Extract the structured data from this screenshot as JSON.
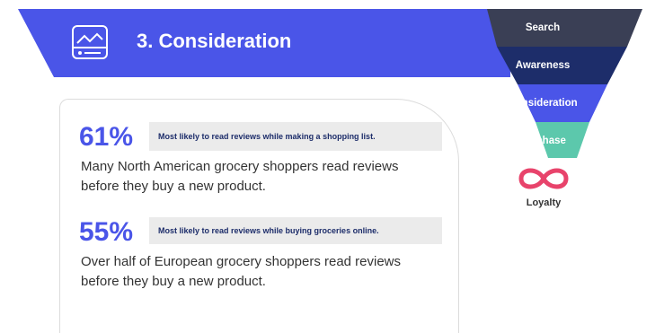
{
  "banner": {
    "title": "3. Consideration",
    "color": "#4a55e8",
    "icon": "chart-card-icon"
  },
  "funnel": {
    "stages": [
      {
        "label": "Search",
        "color": "#3a3f55"
      },
      {
        "label": "Awareness",
        "color": "#1d2d6a"
      },
      {
        "label": "Consideration",
        "color": "#4a55e8"
      },
      {
        "label": "Purchase",
        "color": "#5cc8ac"
      }
    ],
    "loyalty": {
      "label": "Loyalty",
      "icon": "infinity-icon",
      "color": "#e8436b"
    }
  },
  "stats": [
    {
      "value": "61%",
      "highlight": "Most likely to read reviews while making a shopping list.",
      "description": "Many North American grocery shoppers read reviews before they buy a new product."
    },
    {
      "value": "55%",
      "highlight": "Most likely to read reviews while buying groceries online.",
      "description": "Over half of European grocery shoppers read reviews before they buy a new product."
    }
  ]
}
